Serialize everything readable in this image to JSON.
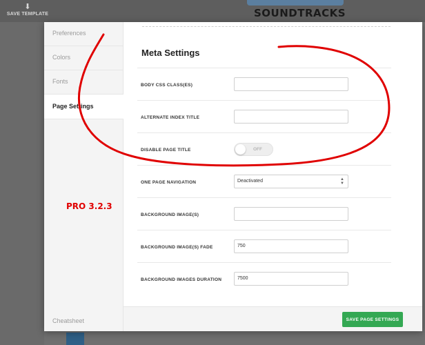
{
  "background": {
    "save_template_icon": "download-icon",
    "save_template_label": "SAVE TEMPLATE",
    "logo_text": "SOUNDTRACKS"
  },
  "modal": {
    "tabs": [
      {
        "label": "Preferences",
        "active": false
      },
      {
        "label": "Colors",
        "active": false
      },
      {
        "label": "Fonts",
        "active": false
      },
      {
        "label": "Page Settings",
        "active": true
      }
    ],
    "version_note": "PRO 3.2.3",
    "cheatsheet_label": "Cheatsheet",
    "section_title": "Meta Settings",
    "fields": {
      "body_css": {
        "label": "BODY CSS CLASS(ES)",
        "value": ""
      },
      "alt_index_title": {
        "label": "ALTERNATE INDEX TITLE",
        "value": ""
      },
      "disable_page_title": {
        "label": "DISABLE PAGE TITLE",
        "state": "OFF"
      },
      "one_page_nav": {
        "label": "ONE PAGE NAVIGATION",
        "value": "Deactivated"
      },
      "bg_images": {
        "label": "BACKGROUND IMAGE(S)",
        "value": ""
      },
      "bg_fade": {
        "label": "BACKGROUND IMAGE(S) FADE",
        "value": "750"
      },
      "bg_duration": {
        "label": "BACKGROUND IMAGES DURATION",
        "value": "7500"
      }
    },
    "save_button_label": "SAVE PAGE SETTINGS"
  },
  "colors": {
    "accent_green": "#34a853",
    "annotation_red": "#e00000"
  }
}
